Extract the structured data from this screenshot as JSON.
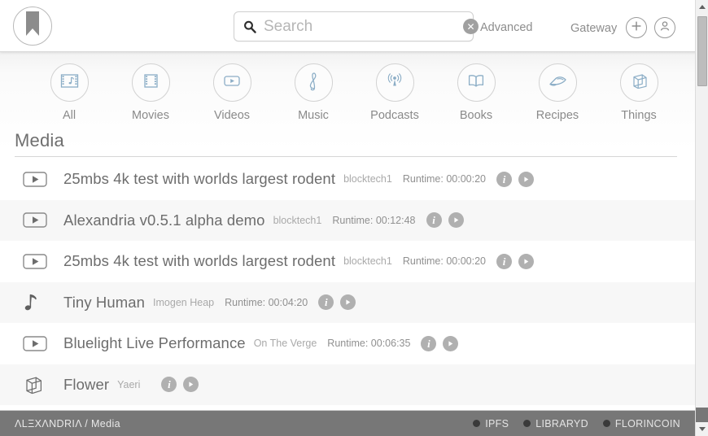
{
  "header": {
    "logo_icon": "bookmark-icon",
    "search": {
      "value": "",
      "placeholder": "Search",
      "search_icon": "search-icon",
      "clear_icon": "clear-circle-icon",
      "clear_glyph": "✕"
    },
    "advanced_label": "Advanced",
    "gateway_label": "Gateway",
    "add_icon": "plus-circle-icon",
    "account_icon": "user-circle-icon"
  },
  "categories": [
    {
      "label": "All",
      "icon": "film-music-icon"
    },
    {
      "label": "Movies",
      "icon": "film-strip-icon"
    },
    {
      "label": "Videos",
      "icon": "video-play-icon"
    },
    {
      "label": "Music",
      "icon": "treble-clef-icon"
    },
    {
      "label": "Podcasts",
      "icon": "broadcast-antenna-icon"
    },
    {
      "label": "Books",
      "icon": "open-book-icon"
    },
    {
      "label": "Recipes",
      "icon": "cake-slice-icon"
    },
    {
      "label": "Things",
      "icon": "cube-icon"
    }
  ],
  "section": {
    "title": "Media"
  },
  "list": {
    "runtime_prefix": "Runtime: ",
    "info_glyph": "i",
    "rows": [
      {
        "icon": "video-play-icon",
        "title": "25mbs 4k test with worlds largest rodent",
        "artist": "blocktech1",
        "runtime": "Runtime: 00:00:20"
      },
      {
        "icon": "video-play-icon",
        "title": "Alexandria v0.5.1 alpha demo",
        "artist": "blocktech1",
        "runtime": "Runtime: 00:12:48"
      },
      {
        "icon": "video-play-icon",
        "title": "25mbs 4k test with worlds largest rodent",
        "artist": "blocktech1",
        "runtime": "Runtime: 00:00:20"
      },
      {
        "icon": "music-note-icon",
        "title": "Tiny Human",
        "artist": "Imogen Heap",
        "runtime": "Runtime: 00:04:20"
      },
      {
        "icon": "video-play-icon",
        "title": "Bluelight Live Performance",
        "artist": "On The Verge",
        "runtime": "Runtime: 00:06:35"
      },
      {
        "icon": "cube-icon",
        "title": "Flower",
        "artist": "Yaeri",
        "runtime": ""
      }
    ]
  },
  "footer": {
    "brand": "ΛLΞXΛNDRIΛ / Media",
    "statuses": [
      {
        "label": "IPFS",
        "color": "#3a3a3a"
      },
      {
        "label": "LIBRARYD",
        "color": "#3a3a3a"
      },
      {
        "label": "FLORINCOIN",
        "color": "#3a3a3a"
      }
    ]
  },
  "scrollbar": {
    "up_icon": "scroll-up-arrow-icon",
    "down_icon": "scroll-down-arrow-icon",
    "thumb": "scroll-thumb"
  },
  "colors": {
    "icon_blue": "#8badc6",
    "text_grey": "#6d6d6d",
    "footer_bg": "#777777"
  }
}
